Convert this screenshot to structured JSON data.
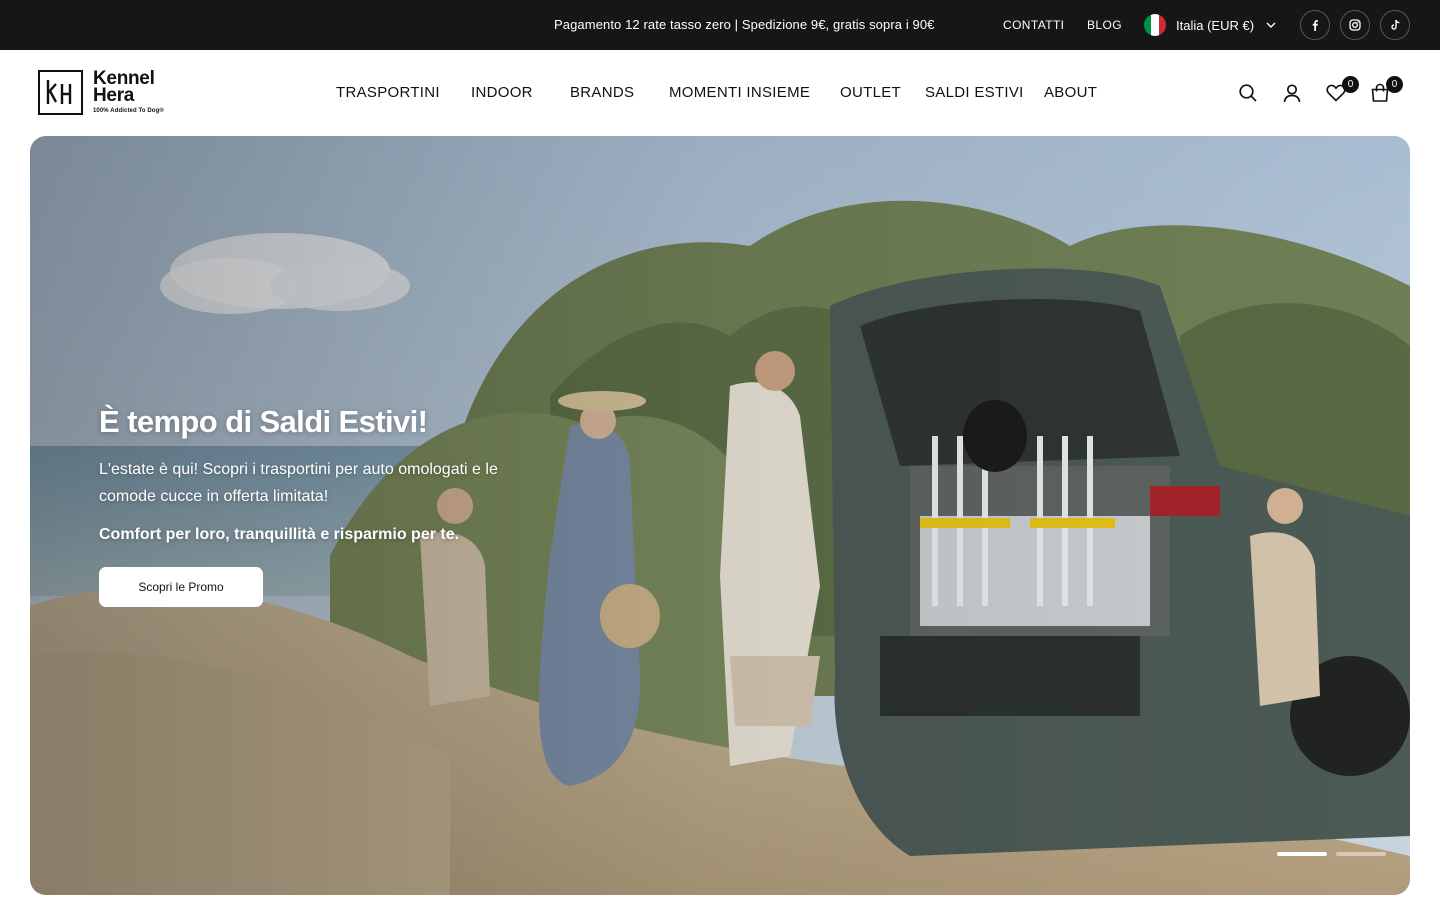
{
  "announcement": {
    "text": "Pagamento 12 rate tasso zero | Spedizione 9€, gratis sopra i 90€",
    "links": [
      "CONTATTI",
      "BLOG"
    ],
    "country": {
      "label": "Italia (EUR €)",
      "flag_colors": [
        "#009246",
        "#ffffff",
        "#ce2b37"
      ]
    },
    "social": [
      {
        "name": "facebook",
        "glyph": "f"
      },
      {
        "name": "instagram",
        "glyph": "◎"
      },
      {
        "name": "tiktok",
        "glyph": "♪"
      }
    ]
  },
  "logo": {
    "line1": "Kennel",
    "line2": "Hera",
    "tagline": "100% Addicted To Dog®"
  },
  "nav": {
    "items": [
      "TRASPORTINI",
      "INDOOR",
      "BRANDS",
      "MOMENTI INSIEME",
      "OUTLET",
      "SALDI ESTIVI",
      "ABOUT"
    ]
  },
  "header_icons": {
    "search": "search-icon",
    "account": "account-icon",
    "wishlist": {
      "icon": "heart-icon",
      "count": "0"
    },
    "cart": {
      "icon": "cart-icon",
      "count": "0"
    }
  },
  "hero": {
    "title": "È tempo di Saldi Estivi!",
    "text": "L'estate è qui! Scopri i trasportini per auto omologati e le comode cucce in offerta limitata!",
    "bold": "Comfort per loro, tranquillità e risparmio per te.",
    "cta": "Scopri le Promo",
    "slides_total": 2,
    "active_slide": 1
  },
  "colors": {
    "topbar_bg": "#161616",
    "text_dark": "#111111",
    "white": "#ffffff"
  }
}
